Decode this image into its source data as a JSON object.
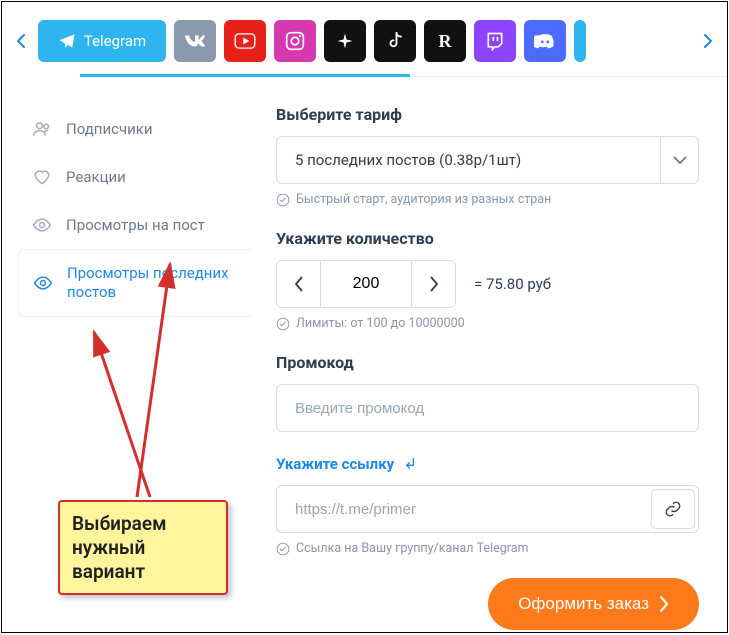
{
  "tabs": {
    "telegram": "Telegram",
    "r": "R"
  },
  "sidebar": {
    "items": [
      {
        "label": "Подписчики"
      },
      {
        "label": "Реакции"
      },
      {
        "label": "Просмотры на пост"
      },
      {
        "label": "Просмотры последних постов"
      }
    ]
  },
  "tariff": {
    "label": "Выберите тариф",
    "selected": "5 последних постов (0.38р/1шт)",
    "hint": "Быстрый старт, аудитория из разных стран"
  },
  "quantity": {
    "label": "Укажите количество",
    "value": "200",
    "price_text": "= 75.80 руб",
    "hint": "Лимиты: от 100 до 10000000"
  },
  "promo": {
    "label": "Промокод",
    "placeholder": "Введите промокод"
  },
  "link": {
    "label": "Укажите ссылку",
    "placeholder": "https://t.me/primer",
    "hint": "Ссылка на Вашу группу/канал Telegram"
  },
  "submit": {
    "label": "Оформить заказ"
  },
  "annotation": {
    "text": "Выбираем нужный вариант"
  }
}
